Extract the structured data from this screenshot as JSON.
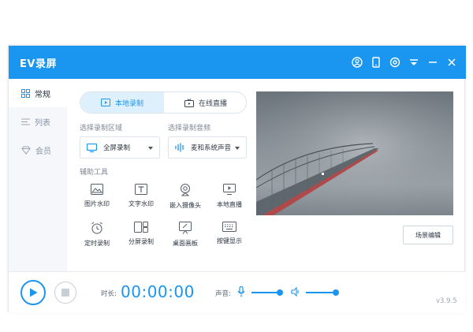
{
  "app": {
    "title": "EV录屏",
    "version": "v3.9.5"
  },
  "titlebar_icons": [
    "user-icon",
    "phone-icon",
    "settings-icon",
    "menu-icon",
    "minimize-icon",
    "close-icon"
  ],
  "sidebar": {
    "items": [
      {
        "label": "常规",
        "icon": "grid-icon",
        "active": true
      },
      {
        "label": "列表",
        "icon": "list-icon",
        "active": false
      },
      {
        "label": "会员",
        "icon": "diamond-icon",
        "active": false
      }
    ]
  },
  "mode": {
    "local": "本地录制",
    "live": "在线直播",
    "active": "local"
  },
  "region": {
    "label": "选择录制区域",
    "value": "全屏录制"
  },
  "audio": {
    "label": "选择录制音频",
    "value": "麦和系统声音"
  },
  "tools": {
    "label": "辅助工具",
    "items": [
      {
        "label": "图片水印",
        "icon": "image-icon"
      },
      {
        "label": "文字水印",
        "icon": "text-icon"
      },
      {
        "label": "嵌入摄像头",
        "icon": "camera-icon"
      },
      {
        "label": "本地直播",
        "icon": "monitor-play-icon"
      },
      {
        "label": "定时录制",
        "icon": "alarm-icon"
      },
      {
        "label": "分屏录制",
        "icon": "split-screen-icon"
      },
      {
        "label": "桌面画板",
        "icon": "whiteboard-icon"
      },
      {
        "label": "按键显示",
        "icon": "keyboard-icon"
      }
    ]
  },
  "scene_button": "场景编辑",
  "controls": {
    "duration_label": "时长:",
    "duration_value": "00:00:00",
    "volume_label": "声音:",
    "mic_level": 0.9,
    "speaker_level": 0.9
  },
  "colors": {
    "accent": "#1a96f0",
    "sidebar_bg": "#f5f7fa"
  }
}
